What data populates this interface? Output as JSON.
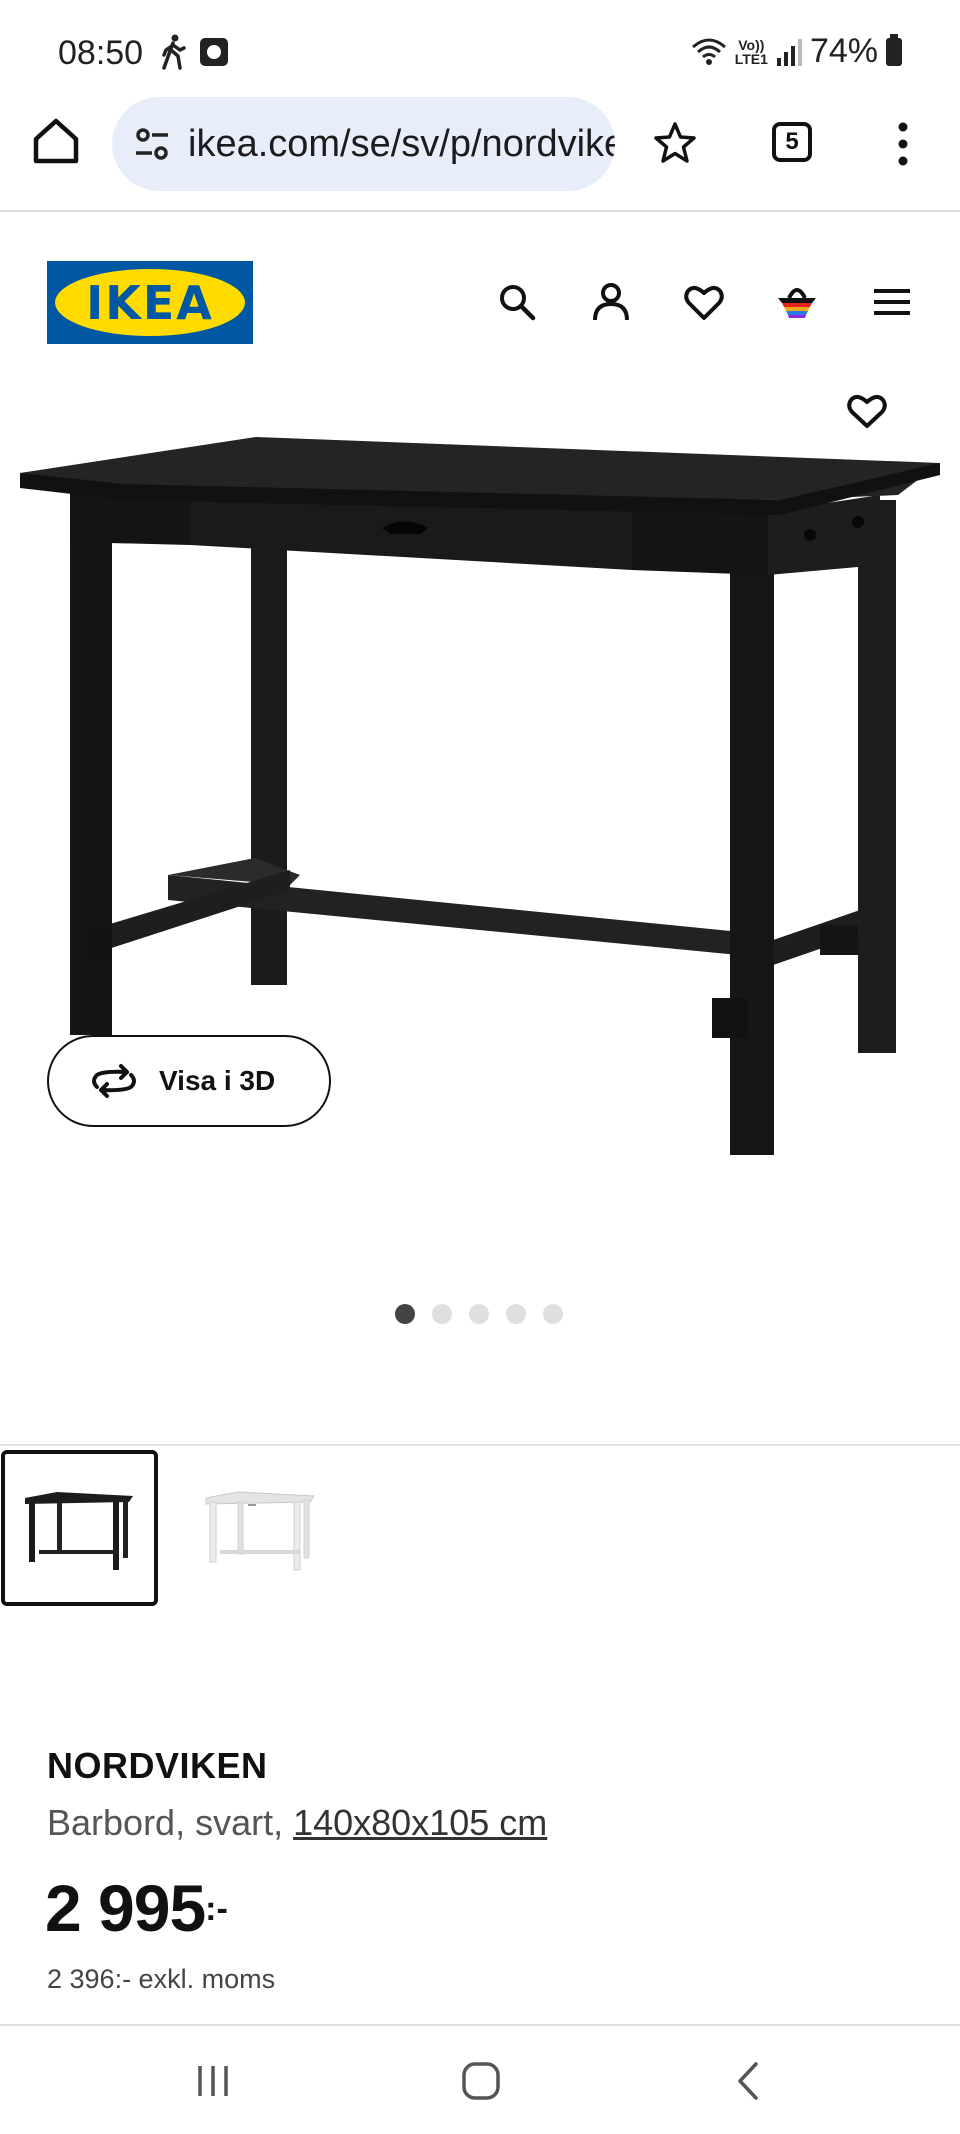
{
  "status_bar": {
    "time": "08:50",
    "network_top": "Vo))",
    "network_bottom": "LTE1",
    "battery": "74%"
  },
  "browser": {
    "url": "ikea.com/se/sv/p/nordviken",
    "tab_count": "5"
  },
  "site": {
    "logo_text": "IKEA",
    "brand_colors": {
      "blue": "#0058a3",
      "yellow": "#ffdb00"
    }
  },
  "header_icons": [
    "search-icon",
    "account-icon",
    "heart-icon",
    "basket-icon",
    "hamburger-menu-icon"
  ],
  "gallery": {
    "view_3d_label": "Visa i 3D",
    "dot_count": 5,
    "active_dot": 1,
    "thumbnails": [
      {
        "variant": "black",
        "selected": true
      },
      {
        "variant": "white",
        "selected": false
      }
    ]
  },
  "product": {
    "name": "NORDVIKEN",
    "description": "Barbord, svart, ",
    "dimensions": "140x80x105 cm",
    "price": "2 995",
    "price_suffix": ":-",
    "price_excl_vat": "2 396:- exkl. moms"
  }
}
